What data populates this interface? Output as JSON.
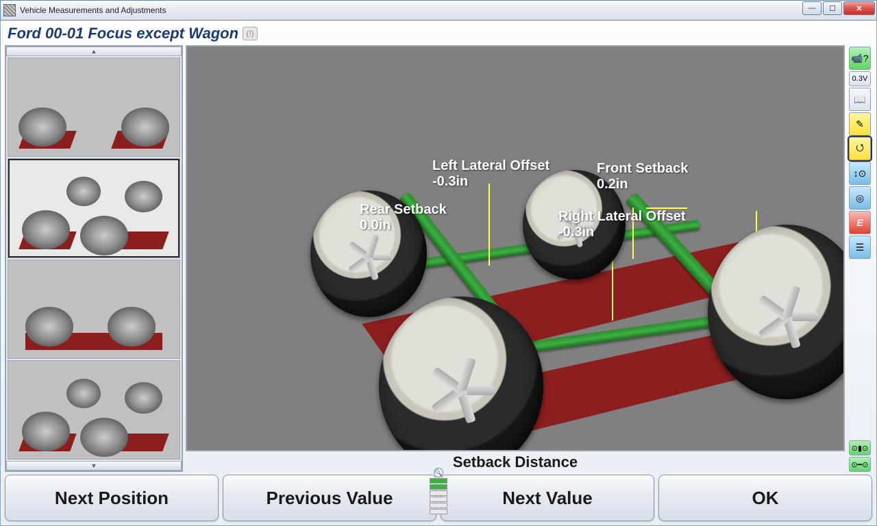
{
  "window": {
    "title": "Vehicle Measurements and Adjustments"
  },
  "vehicle": {
    "name": "Ford 00-01 Focus except Wagon"
  },
  "measurements": {
    "left_lateral_offset": {
      "label": "Left Lateral Offset",
      "value": "-0.3in"
    },
    "front_setback": {
      "label": "Front Setback",
      "value": "0.2in"
    },
    "rear_setback": {
      "label": "Rear Setback",
      "value": "0.0in"
    },
    "right_lateral_offset": {
      "label": "Right Lateral Offset",
      "value": "-0.3in"
    }
  },
  "status": "Setback Distance",
  "buttons": {
    "next_position": "Next Position",
    "previous_value": "Previous Value",
    "next_value": "Next Value",
    "ok": "OK"
  },
  "right_tools": {
    "help_label": "?",
    "voltage": "0.3V",
    "express": "E"
  },
  "thumbs": [
    "front-view",
    "iso-view",
    "side-view",
    "iso-view-2"
  ],
  "thumb_selected_index": 1
}
